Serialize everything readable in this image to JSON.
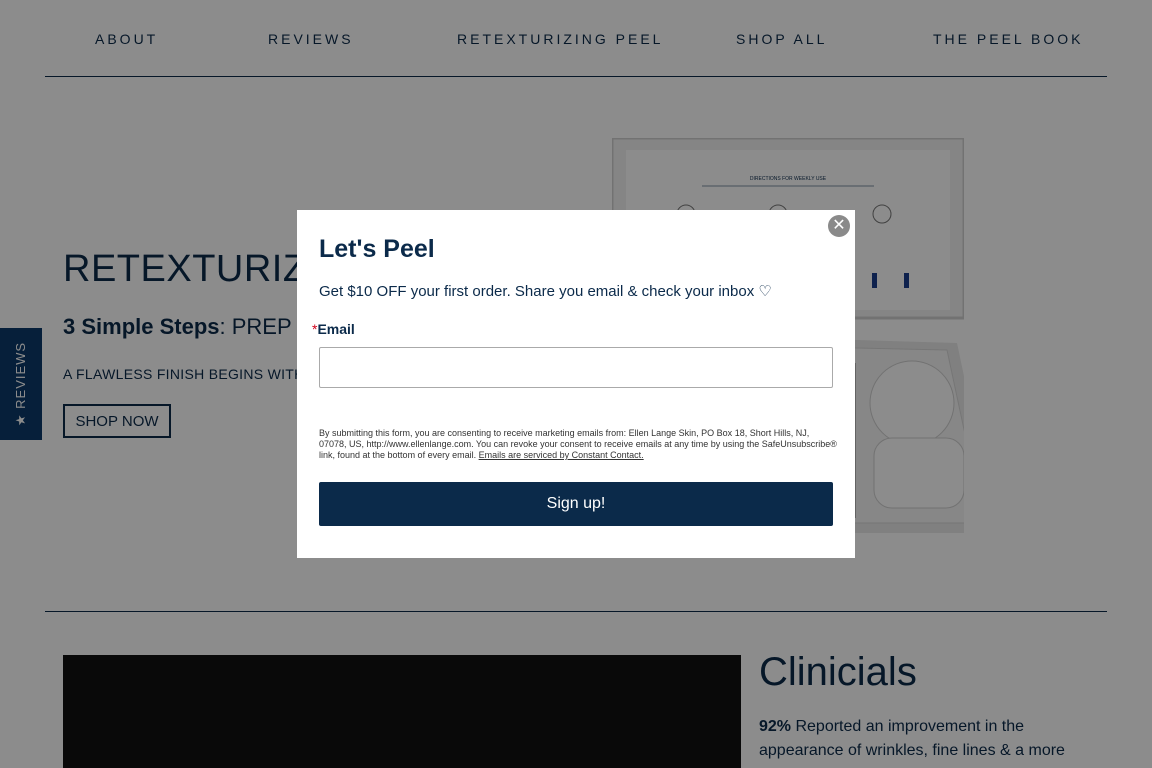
{
  "nav": {
    "items": [
      "ABOUT",
      "REVIEWS",
      "RETEXTURIZING PEEL",
      "SHOP ALL",
      "THE PEEL BOOK"
    ]
  },
  "hero": {
    "title": "RETEXTURIZING",
    "steps_bold": "3 Simple Steps",
    "steps_rest": ":  PREP ▪",
    "tagline": "A FLAWLESS FINISH BEGINS WITH A",
    "shop_button": "SHOP NOW"
  },
  "product": {
    "card_heading": "DIRECTIONS FOR WEEKLY USE"
  },
  "reviews_tab": {
    "label": "★ REVIEWS"
  },
  "clinicials": {
    "title": "Clinicials",
    "stat": "92%",
    "text": " Reported an improvement in the appearance of wrinkles, fine lines & a more"
  },
  "modal": {
    "close_symbol": "✕",
    "title": "Let's Peel",
    "offer": "Get $10 OFF your first order. Share you email & check your inbox ♡",
    "required_mark": "*",
    "email_label": "Email",
    "email_value": "",
    "consent": "By submitting this form, you are consenting to receive marketing emails from: Ellen Lange Skin, PO Box 18, Short Hills, NJ, 07078, US, http://www.ellenlange.com. You can revoke your consent to receive emails at any time by using the SafeUnsubscribe® link, found at the bottom of every email. ",
    "consent_link": "Emails are serviced by Constant Contact.",
    "signup_button": "Sign up!"
  },
  "colors": {
    "brand_navy": "#0b2a4a",
    "reviews_tab": "#0b3a6a",
    "overlay": "rgba(0,0,0,0.45)"
  }
}
